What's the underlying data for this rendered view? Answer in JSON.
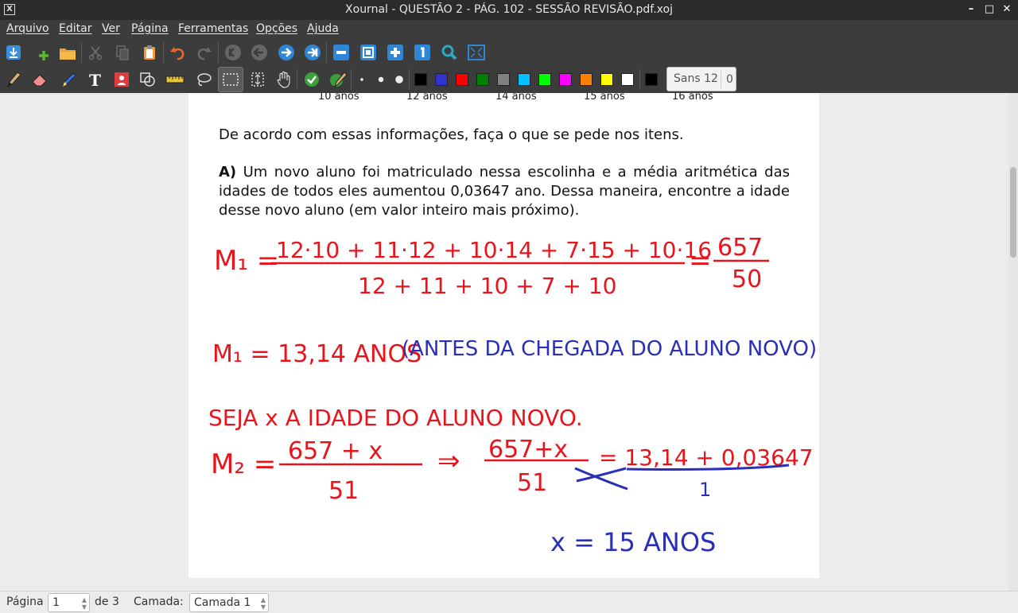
{
  "window": {
    "title": "Xournal - QUESTÃO 2 - PÁG. 102 - SESSÃO REVISÃO.pdf.xoj",
    "app_icon": "X",
    "minimize": "–",
    "maximize": "□",
    "close": "✕"
  },
  "menu": {
    "items": [
      "Arquivo",
      "Editar",
      "Ver",
      "Página",
      "Ferramentas",
      "Opções",
      "Ajuda"
    ]
  },
  "toolbar": {
    "font_name": "Sans 12",
    "font_size": "0"
  },
  "colors": {
    "palette": [
      "#000000",
      "#3333cc",
      "#ff0000",
      "#008000",
      "#808080",
      "#00c0ff",
      "#00ff00",
      "#ff00ff",
      "#ff8000",
      "#ffff00",
      "#ffffff"
    ],
    "current": "#000000",
    "ink_red": "#e8141c",
    "ink_blue": "#2a2fb8"
  },
  "page": {
    "axis_labels": [
      "10 anos",
      "12 anos",
      "14 anos",
      "15 anos",
      "16 anos"
    ],
    "intro": "De acordo com essas informações, faça o que se pede nos itens.",
    "question_label": "A)",
    "question_text": " Um novo aluno foi matriculado nessa escolinha e a média aritmética das idades de todos eles aumentou 0,03647 ano. Dessa maneira, encontre a idade desse novo aluno (em valor inteiro mais próximo).",
    "handwriting": {
      "m1_label": "M₁ =",
      "m1_numerator": "12·10 + 11·12 + 10·14 + 7·15 + 10·16",
      "m1_denominator": "12 + 11 + 10 + 7 + 10",
      "m1_result_num": "657",
      "m1_result_den": "50",
      "m1_value": "M₁ = 13,14 ANOS",
      "m1_note": "(ANTES DA CHEGADA DO ALUNO NOVO)",
      "seja": "SEJA x A IDADE DO ALUNO NOVO.",
      "m2_label": "M₂ =",
      "m2_numerator": "657 + x",
      "m2_denominator": "51",
      "arrow": "⇒",
      "frac2_num": "657+x",
      "frac2_den": "51",
      "eq_rhs": "= 13,14 + 0,03647",
      "eq_rhs_den": "1",
      "answer": "x = 15 ANOS"
    }
  },
  "status": {
    "page_label": "Página",
    "page_value": "1",
    "page_total": "de 3",
    "layer_label": "Camada:",
    "layer_value": "Camada 1"
  }
}
